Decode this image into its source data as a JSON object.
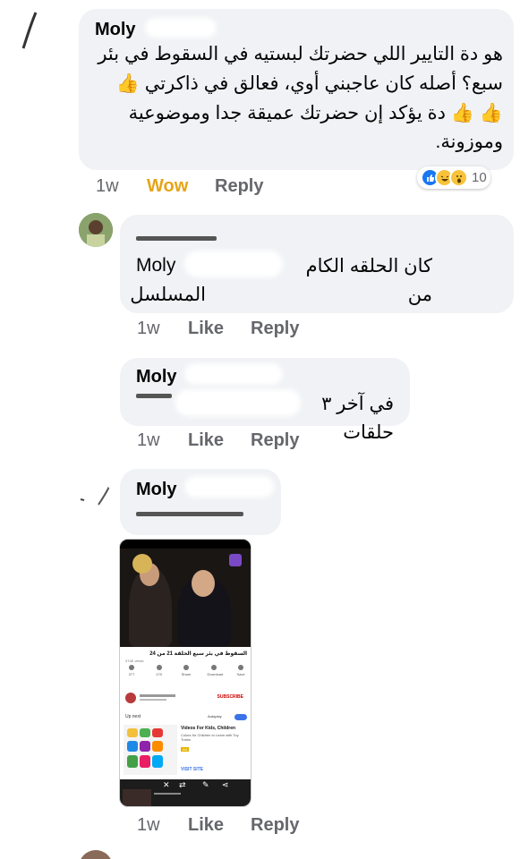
{
  "comments": [
    {
      "author": "Moly",
      "text": "هو دة التايير اللي حضرتك لبستيه في السقوط في بئر سبع؟ أصله كان عاجبني أوي، فعالق في ذاكرتي",
      "text_part2": "دة يؤكد إن حضرتك عميقة جدا وموضوعية وموزونة.",
      "time": "1w",
      "reaction_label": "Wow",
      "reply_label": "Reply",
      "reaction_count": "10",
      "reaction_icons": [
        "like-reaction",
        "haha-reaction",
        "wow-reaction"
      ]
    },
    {
      "author": "Moly",
      "text": "كان الحلقه الكام من",
      "text_line2": "المسلسل",
      "time": "1w",
      "like_label": "Like",
      "reply_label": "Reply"
    },
    {
      "author": "Moly",
      "text": "في آخر ٣ حلقات",
      "time": "1w",
      "like_label": "Like",
      "reply_label": "Reply"
    },
    {
      "author": "Moly",
      "time": "1w",
      "like_label": "Like",
      "reply_label": "Reply",
      "attachment": {
        "video_title": "السقوط في بئر سبع الحلقة 21 من 24",
        "views": "374K views",
        "actions": [
          "377",
          "175",
          "Share",
          "Download",
          "Save"
        ],
        "subscribe_label": "SUBSCRIBE",
        "up_next_label": "Up next",
        "autoplay_label": "Autoplay",
        "ad_title": "Videos For Kids, Children",
        "ad_description": "Colors for Children to Learn with Toy Trains",
        "ad_badge": "Ad",
        "visit_label": "VISIT SITE"
      }
    }
  ],
  "emoji": {
    "thumbs_up": "👍"
  },
  "colors": {
    "bubble": "#f0f2f5",
    "wow": "#e7a416",
    "like_blue": "#1877f2",
    "muted": "#65676b"
  }
}
